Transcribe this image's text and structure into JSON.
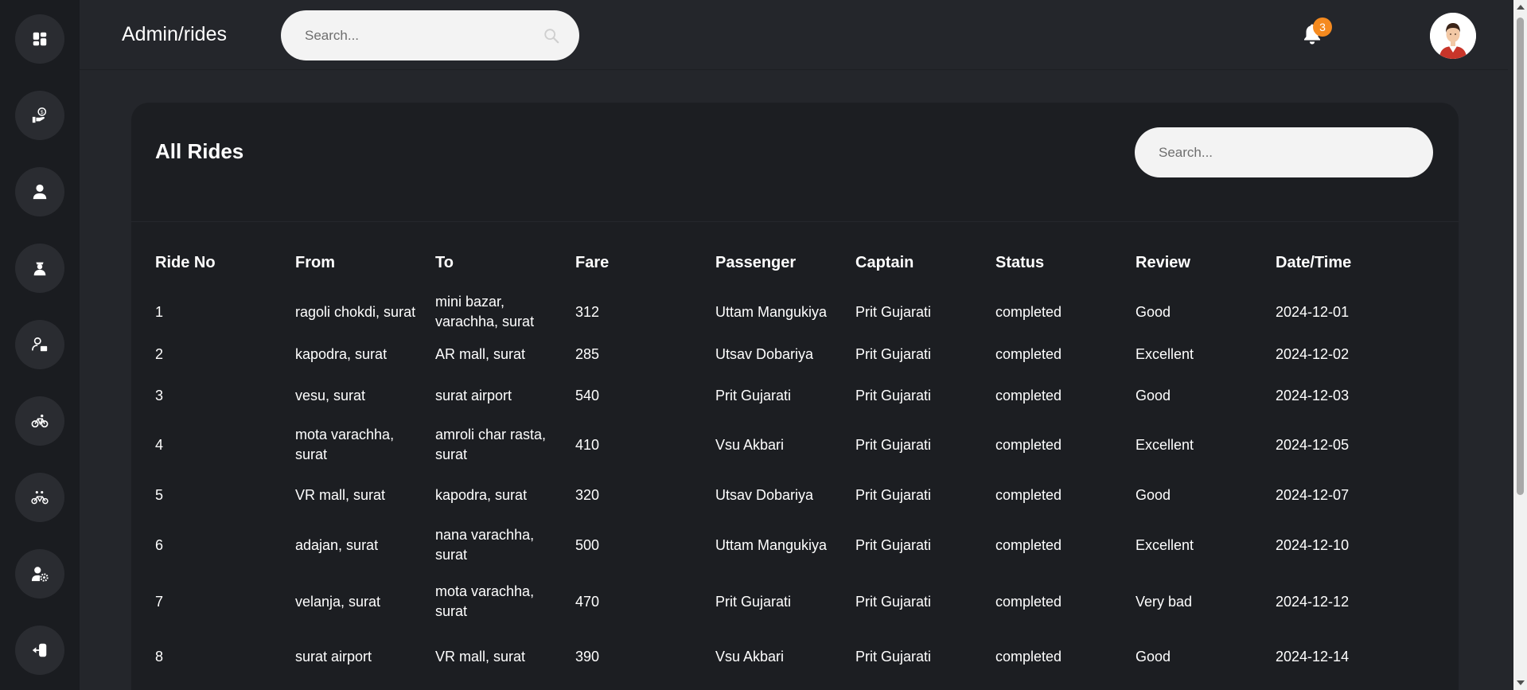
{
  "header": {
    "breadcrumb": "Admin/rides",
    "search_placeholder": "Search...",
    "notification_count": "3"
  },
  "sidebar": {
    "items": [
      {
        "icon": "dashboard-icon"
      },
      {
        "icon": "payment-icon"
      },
      {
        "icon": "user-icon"
      },
      {
        "icon": "captain-icon"
      },
      {
        "icon": "user-card-icon"
      },
      {
        "icon": "bike-icon"
      },
      {
        "icon": "tandem-bike-icon"
      },
      {
        "icon": "user-settings-icon"
      },
      {
        "icon": "logout-icon"
      }
    ]
  },
  "card": {
    "title": "All Rides",
    "search_placeholder": "Search..."
  },
  "table": {
    "columns": [
      "Ride No",
      "From",
      "To",
      "Fare",
      "Passenger",
      "Captain",
      "Status",
      "Review",
      "Date/Time"
    ],
    "rows": [
      [
        "1",
        "ragoli chokdi, surat",
        "mini bazar, varachha, surat",
        "312",
        "Uttam Mangukiya",
        "Prit Gujarati",
        "completed",
        "Good",
        "2024-12-01"
      ],
      [
        "2",
        "kapodra, surat",
        "AR mall, surat",
        "285",
        "Utsav Dobariya",
        "Prit Gujarati",
        "completed",
        "Excellent",
        "2024-12-02"
      ],
      [
        "3",
        "vesu, surat",
        "surat airport",
        "540",
        "Prit Gujarati",
        "Prit Gujarati",
        "completed",
        "Good",
        "2024-12-03"
      ],
      [
        "4",
        "mota varachha, surat",
        "amroli char rasta, surat",
        "410",
        "Vsu Akbari",
        "Prit Gujarati",
        "completed",
        "Excellent",
        "2024-12-05"
      ],
      [
        "5",
        "VR mall, surat",
        "kapodra, surat",
        "320",
        "Utsav Dobariya",
        "Prit Gujarati",
        "completed",
        "Good",
        "2024-12-07"
      ],
      [
        "6",
        "adajan, surat",
        "nana varachha, surat",
        "500",
        "Uttam Mangukiya",
        "Prit Gujarati",
        "completed",
        "Excellent",
        "2024-12-10"
      ],
      [
        "7",
        "velanja, surat",
        "mota varachha, surat",
        "470",
        "Prit Gujarati",
        "Prit Gujarati",
        "completed",
        "Very bad",
        "2024-12-12"
      ],
      [
        "8",
        "surat airport",
        "VR mall, surat",
        "390",
        "Vsu Akbari",
        "Prit Gujarati",
        "completed",
        "Good",
        "2024-12-14"
      ]
    ]
  },
  "colors": {
    "background": "#24262b",
    "sidebar": "#1a1c20",
    "card": "#1c1e22",
    "badge": "#f58a1f"
  }
}
